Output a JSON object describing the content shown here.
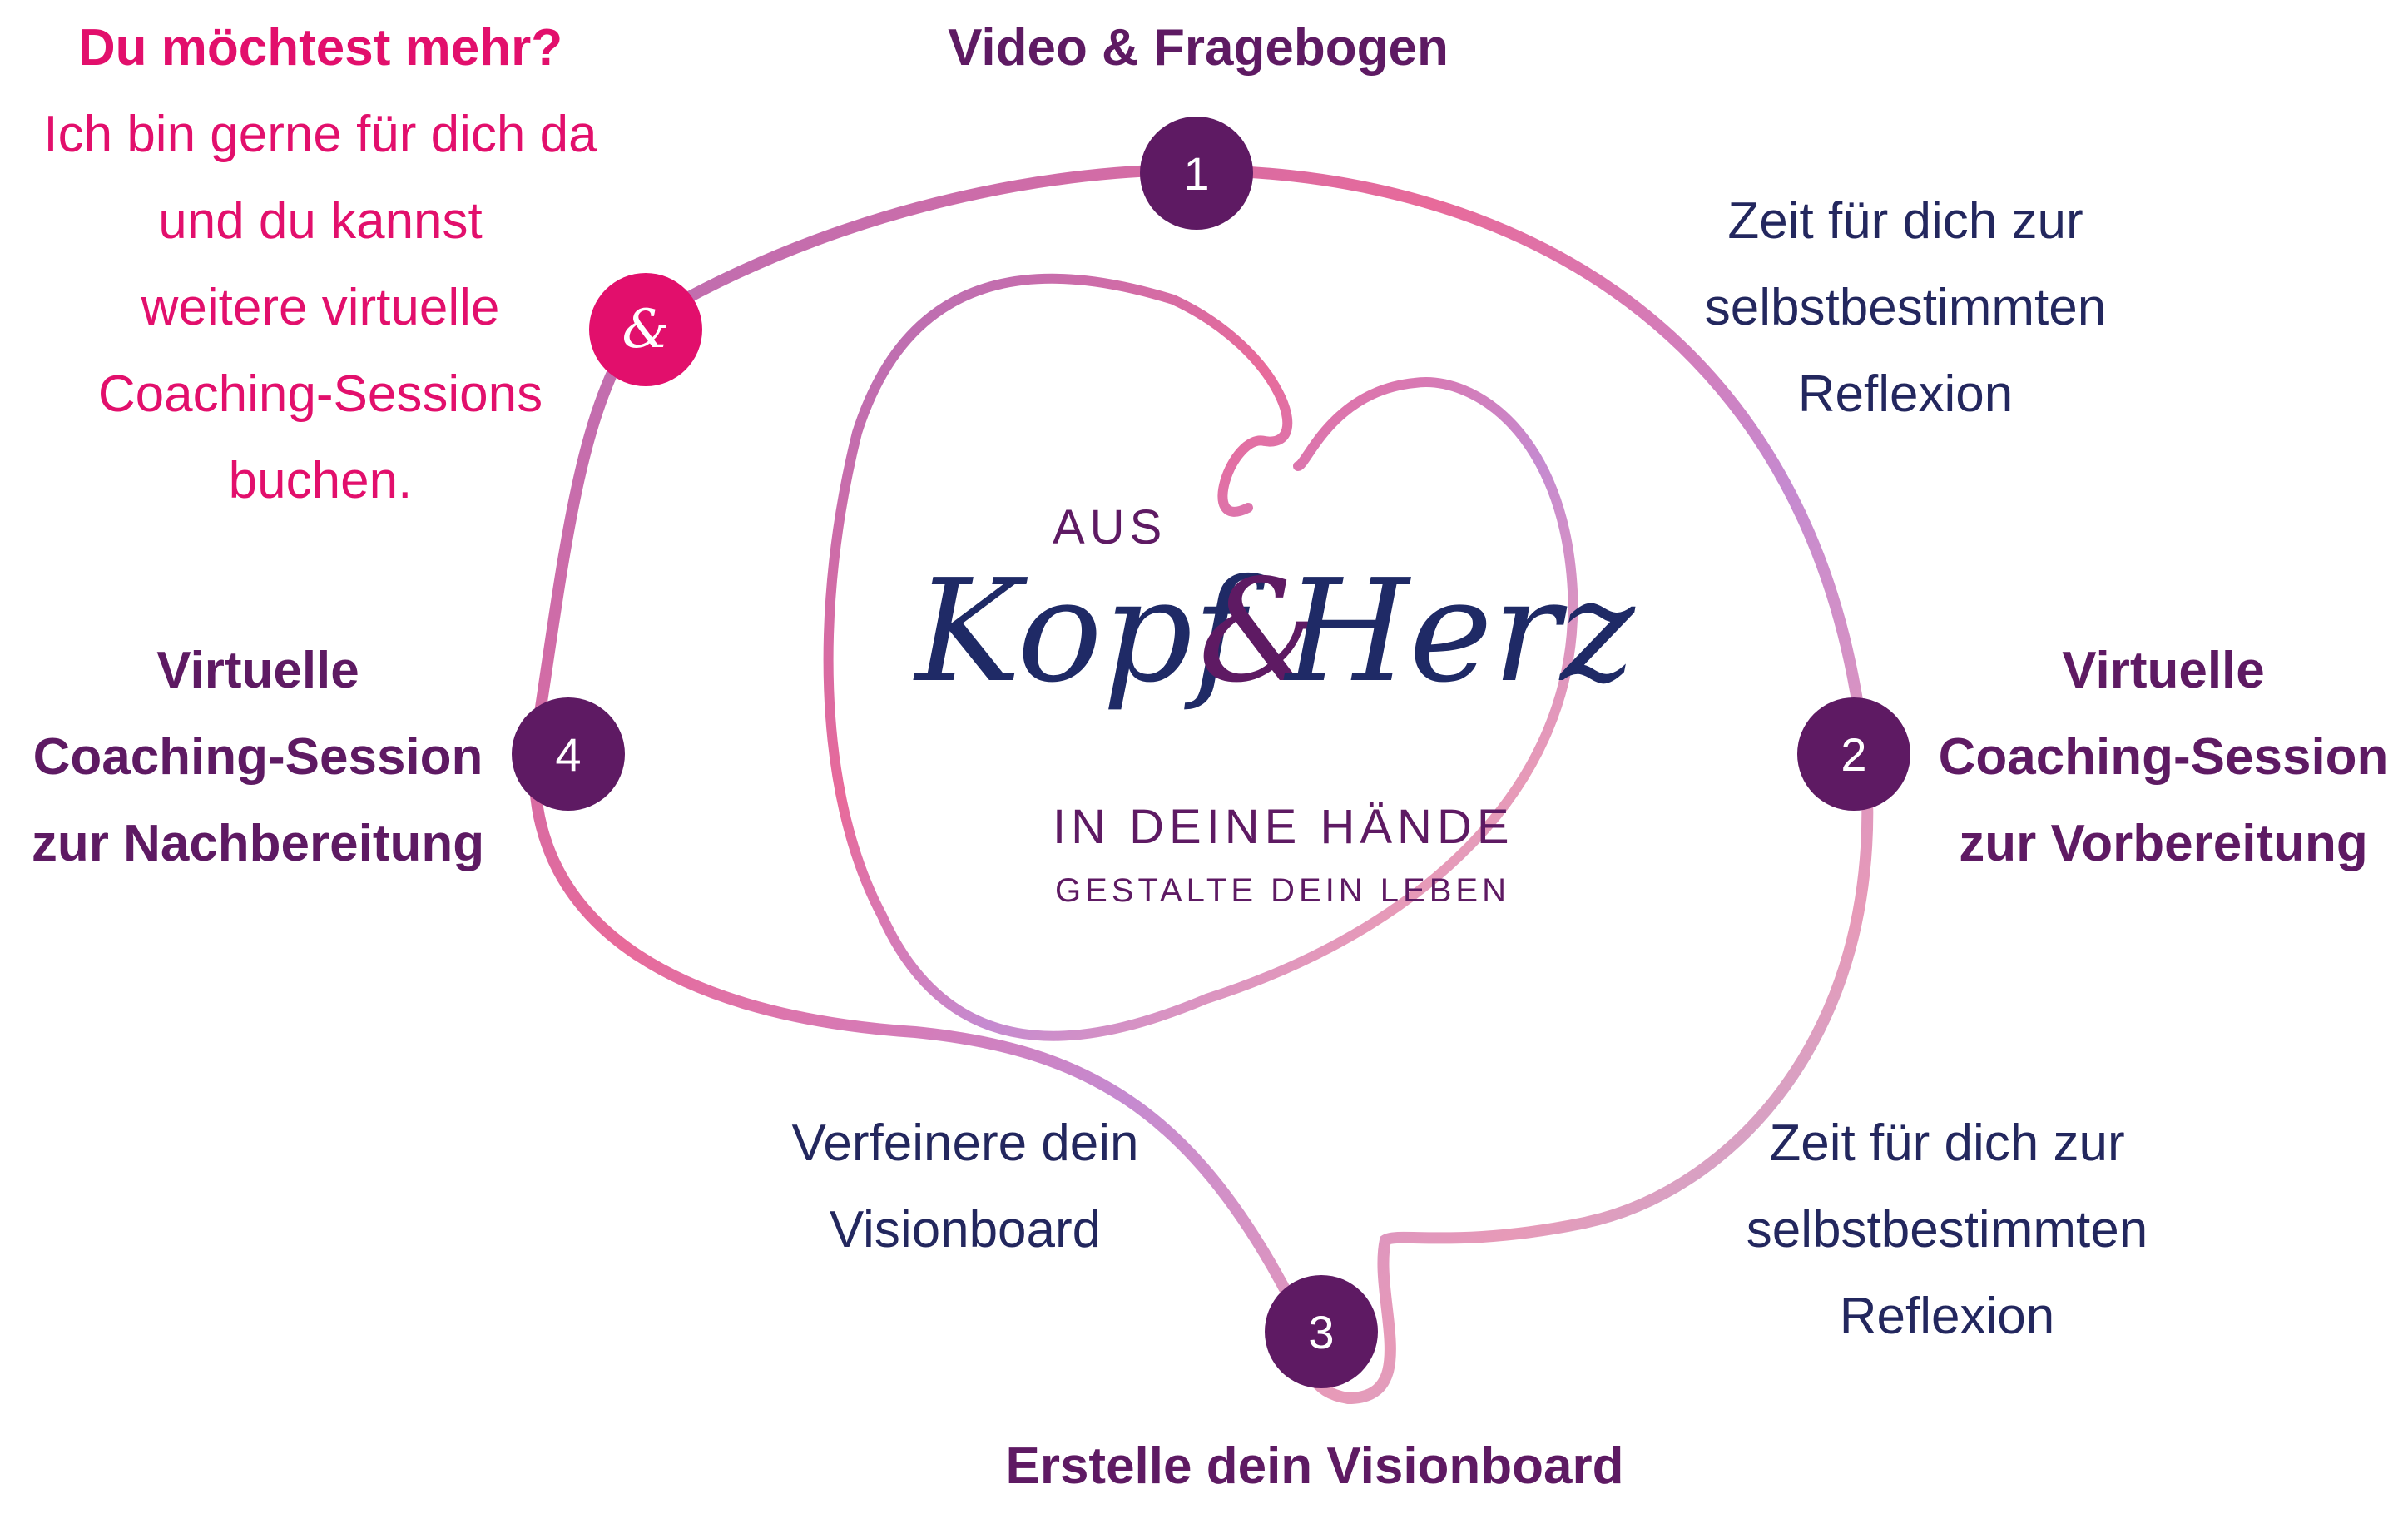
{
  "colors": {
    "purple": "#5e1a63",
    "pink": "#e20f6c",
    "navy": "#23275e",
    "path_start": "#b06fb8",
    "path_mid": "#e86a9a",
    "path_end": "#a7b6e6"
  },
  "steps": [
    {
      "number": "1",
      "title": "Video & Fragebogen"
    },
    {
      "number": "2",
      "title_lines": [
        "Virtuelle",
        "Coaching-Session",
        "zur Vorbereitung"
      ]
    },
    {
      "number": "3",
      "title": "Erstelle dein Visionboard"
    },
    {
      "number": "4",
      "title_lines": [
        "Virtuelle",
        "Coaching-Session",
        "zur Nachbereitung"
      ]
    }
  ],
  "reflection_top": [
    "Zeit für dich zur",
    "selbstbestimmten",
    "Reflexion"
  ],
  "reflection_bottom": [
    "Zeit für dich zur",
    "selbstbestimmten",
    "Reflexion"
  ],
  "refine_note": [
    "Verfeinere dein",
    "Visionboard"
  ],
  "extra": {
    "symbol": "&",
    "title": "Du möchtest mehr?",
    "lines": [
      "Ich bin gerne für dich da",
      "und du kannst",
      "weitere virtuelle",
      "Coaching-Sessions",
      "buchen."
    ]
  },
  "logo": {
    "top": "AUS",
    "word1": "Kopf",
    "amp": "&",
    "word2": "Herz",
    "line1": "IN DEINE HÄNDE",
    "line2": "GESTALTE DEIN LEBEN"
  }
}
